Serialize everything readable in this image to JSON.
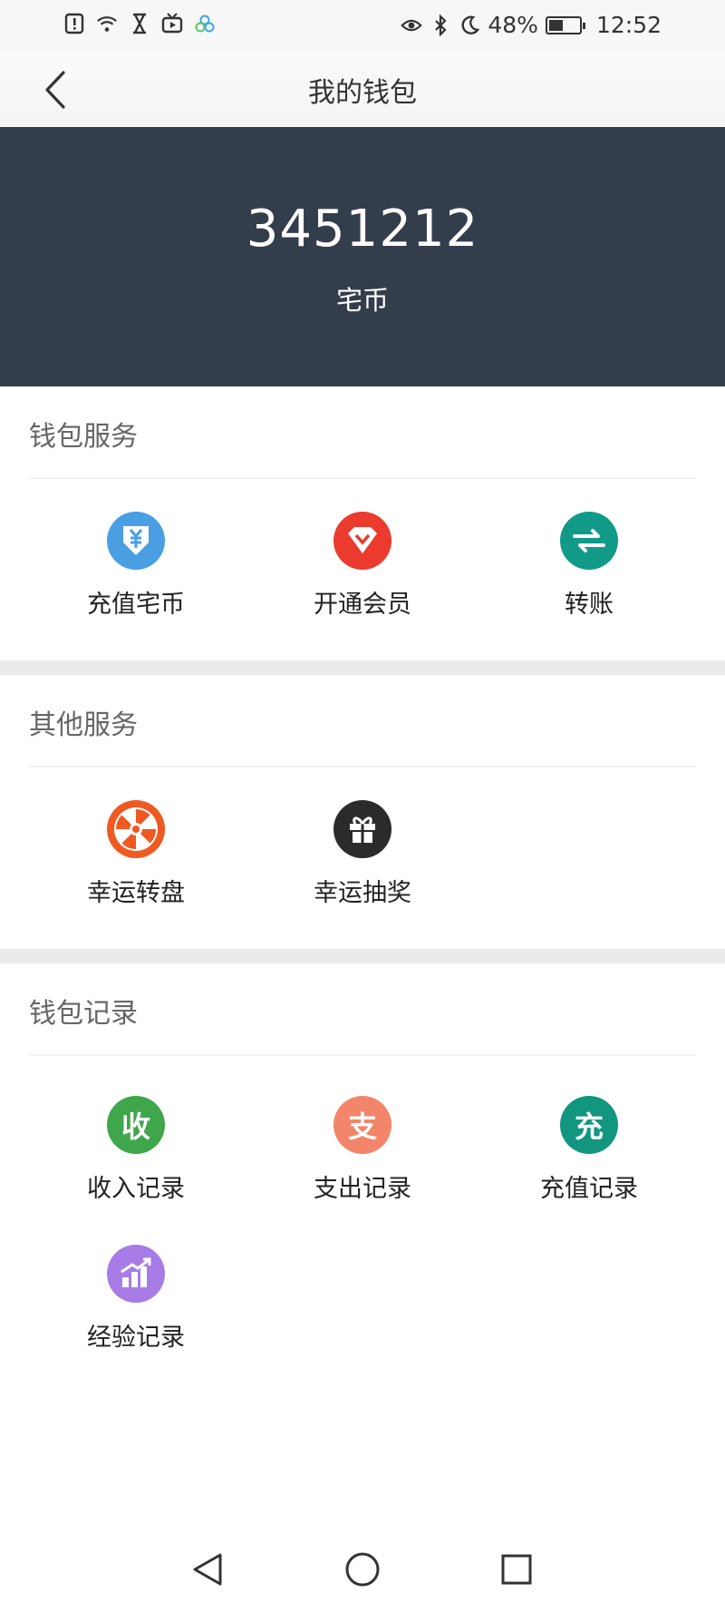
{
  "status_bar": {
    "battery": "48%",
    "battery_level": 0.48,
    "time": "12:52",
    "icons": [
      "alert-icon",
      "wifi-icon",
      "hourglass-icon",
      "tv-icon",
      "cloud-icon",
      "eye-icon",
      "bluetooth-icon",
      "moon-icon",
      "battery-icon"
    ]
  },
  "header": {
    "title": "我的钱包",
    "back_icon": "chevron-left-icon"
  },
  "balance": {
    "value": "3451212",
    "unit": "宅币"
  },
  "sections": {
    "wallet_services": {
      "title": "钱包服务",
      "items": [
        {
          "label": "充值宅币",
          "icon": "yen-download-icon",
          "color": "#4a9fe2"
        },
        {
          "label": "开通会员",
          "icon": "vip-diamond-icon",
          "color": "#ea3b2e"
        },
        {
          "label": "转账",
          "icon": "transfer-arrows-icon",
          "color": "#119a87"
        }
      ]
    },
    "other_services": {
      "title": "其他服务",
      "items": [
        {
          "label": "幸运转盘",
          "icon": "wheel-icon",
          "color": "#ef5a23"
        },
        {
          "label": "幸运抽奖",
          "icon": "gift-icon",
          "color": "#2b2b2b"
        }
      ]
    },
    "wallet_records": {
      "title": "钱包记录",
      "items": [
        {
          "label": "收入记录",
          "icon_char": "收",
          "icon": "income-icon",
          "color": "#3fa64b"
        },
        {
          "label": "支出记录",
          "icon_char": "支",
          "icon": "expense-icon",
          "color": "#f3856a"
        },
        {
          "label": "充值记录",
          "icon_char": "充",
          "icon": "recharge-record-icon",
          "color": "#12967f"
        },
        {
          "label": "经验记录",
          "icon": "bar-chart-icon",
          "color": "#a77ce6"
        }
      ]
    }
  },
  "nav": {
    "icons": [
      "back-triangle-icon",
      "home-circle-icon",
      "recents-square-icon"
    ]
  }
}
